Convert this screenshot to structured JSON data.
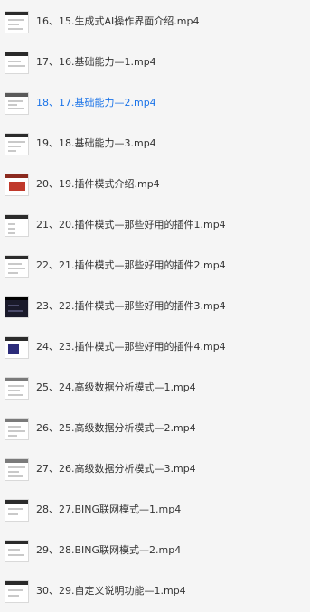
{
  "accent_color": "#1a73e8",
  "text_color": "#333333",
  "playlist": {
    "items": [
      {
        "label": "16、15.生成式AI操作界面介绍.mp4",
        "icon": "video-thumbnail-icon"
      },
      {
        "label": "17、16.基础能力—1.mp4",
        "icon": "video-thumbnail-icon"
      },
      {
        "label": "18、17.基础能力—2.mp4",
        "icon": "video-thumbnail-icon",
        "active": true
      },
      {
        "label": "19、18.基础能力—3.mp4",
        "icon": "video-thumbnail-icon"
      },
      {
        "label": "20、19.插件模式介绍.mp4",
        "icon": "video-thumbnail-icon"
      },
      {
        "label": "21、20.插件模式—那些好用的插件1.mp4",
        "icon": "video-thumbnail-icon"
      },
      {
        "label": "22、21.插件模式—那些好用的插件2.mp4",
        "icon": "video-thumbnail-icon"
      },
      {
        "label": "23、22.插件模式—那些好用的插件3.mp4",
        "icon": "video-thumbnail-icon"
      },
      {
        "label": "24、23.插件模式—那些好用的插件4.mp4",
        "icon": "video-thumbnail-icon"
      },
      {
        "label": "25、24.高级数据分析模式—1.mp4",
        "icon": "video-thumbnail-icon"
      },
      {
        "label": "26、25.高级数据分析模式—2.mp4",
        "icon": "video-thumbnail-icon"
      },
      {
        "label": "27、26.高级数据分析模式—3.mp4",
        "icon": "video-thumbnail-icon"
      },
      {
        "label": "28、27.BING联网模式—1.mp4",
        "icon": "video-thumbnail-icon"
      },
      {
        "label": "29、28.BING联网模式—2.mp4",
        "icon": "video-thumbnail-icon"
      },
      {
        "label": "30、29.自定义说明功能—1.mp4",
        "icon": "video-thumbnail-icon"
      }
    ]
  }
}
